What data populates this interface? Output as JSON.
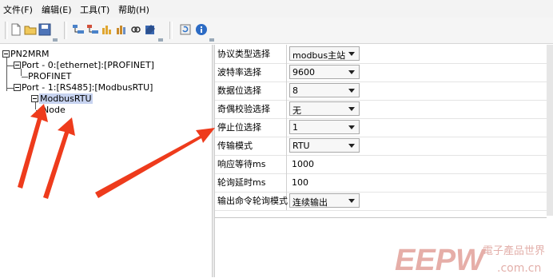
{
  "menu": {
    "file": "文件(F)",
    "edit": "编辑(E)",
    "tools": "工具(T)",
    "help": "帮助(H)"
  },
  "toolbar": {
    "icons": [
      "new-file-icon",
      "open-folder-icon",
      "save-icon",
      "tree-expand-icon",
      "tree-collapse-icon",
      "chart-icon",
      "chart2-icon",
      "link-icon",
      "edit-icon",
      "refresh-icon",
      "info-icon"
    ]
  },
  "tree": {
    "root": "PN2MRM",
    "port0": "Port - 0:[ethernet]:[PROFINET]",
    "profinet": "PROFINET",
    "port1": "Port - 1:[RS485]:[ModbusRTU]",
    "modbusrtu": "ModbusRTU",
    "node": "Node"
  },
  "properties": {
    "rows": [
      {
        "label": "协议类型选择",
        "value": "modbus主站",
        "kind": "combo"
      },
      {
        "label": "波特率选择",
        "value": "9600",
        "kind": "combo"
      },
      {
        "label": "数据位选择",
        "value": "8",
        "kind": "combo"
      },
      {
        "label": "奇偶校验选择",
        "value": "无",
        "kind": "combo"
      },
      {
        "label": "停止位选择",
        "value": "1",
        "kind": "combo"
      },
      {
        "label": "传输模式",
        "value": "RTU",
        "kind": "combo"
      },
      {
        "label": "响应等待ms",
        "value": "1000",
        "kind": "text"
      },
      {
        "label": "轮询延时ms",
        "value": "100",
        "kind": "text"
      },
      {
        "label": "输出命令轮询模式",
        "value": "连续输出",
        "kind": "combo"
      }
    ]
  },
  "watermark": {
    "brand": "EEPW",
    "chinese": "電子產品世界",
    "domain": ".com.cn"
  },
  "colors": {
    "arrow": "#ee3b1c",
    "selection": "#c7d3f0",
    "watermark": "#e0a6a1"
  }
}
